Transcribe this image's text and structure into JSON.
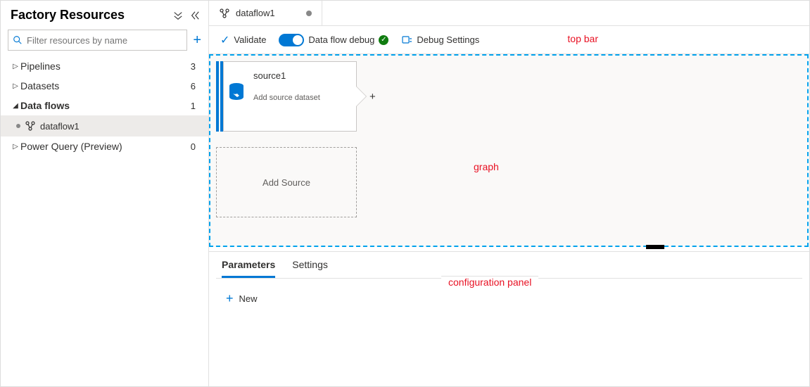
{
  "sidebar": {
    "title": "Factory Resources",
    "filter_placeholder": "Filter resources by name",
    "items": [
      {
        "label": "Pipelines",
        "count": "3",
        "expanded": false,
        "children": []
      },
      {
        "label": "Datasets",
        "count": "6",
        "expanded": false,
        "children": []
      },
      {
        "label": "Data flows",
        "count": "1",
        "expanded": true,
        "children": [
          {
            "label": "dataflow1",
            "active": true
          }
        ]
      },
      {
        "label": "Power Query (Preview)",
        "count": "0",
        "expanded": false,
        "children": []
      }
    ]
  },
  "tabs": {
    "active": {
      "label": "dataflow1",
      "unsaved": true
    }
  },
  "toolbar": {
    "validate_label": "Validate",
    "debug_label": "Data flow debug",
    "debug_enabled": true,
    "debug_settings_label": "Debug Settings"
  },
  "graph": {
    "source_node": {
      "title": "source1",
      "subtitle": "Add source dataset"
    },
    "add_source_label": "Add Source"
  },
  "config": {
    "tabs": [
      "Parameters",
      "Settings"
    ],
    "active_tab": "Parameters",
    "new_label": "New"
  },
  "annotations": {
    "top_bar": "top bar",
    "graph": "graph",
    "config_panel": "configuration panel"
  }
}
